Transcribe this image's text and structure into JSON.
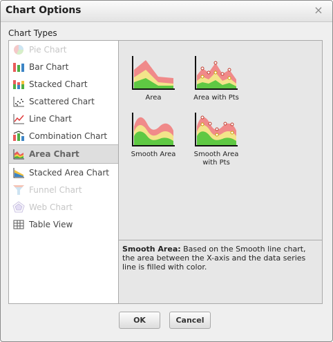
{
  "dialog": {
    "title": "Chart Options",
    "close_glyph": "×"
  },
  "chart_types": {
    "label": "Chart Types",
    "items": [
      {
        "label": "Pie Chart",
        "icon": "pie-chart-icon",
        "state": "disabled"
      },
      {
        "label": "Bar Chart",
        "icon": "bar-chart-icon",
        "state": "enabled"
      },
      {
        "label": "Stacked Chart",
        "icon": "stacked-chart-icon",
        "state": "enabled"
      },
      {
        "label": "Scattered Chart",
        "icon": "scatter-chart-icon",
        "state": "enabled"
      },
      {
        "label": "Line Chart",
        "icon": "line-chart-icon",
        "state": "enabled"
      },
      {
        "label": "Combination Chart",
        "icon": "combination-chart-icon",
        "state": "enabled"
      },
      {
        "label": "Area Chart",
        "icon": "area-chart-icon",
        "state": "selected"
      },
      {
        "label": "Stacked Area Chart",
        "icon": "stacked-area-chart-icon",
        "state": "enabled"
      },
      {
        "label": "Funnel Chart",
        "icon": "funnel-chart-icon",
        "state": "disabled"
      },
      {
        "label": "Web Chart",
        "icon": "web-chart-icon",
        "state": "disabled"
      },
      {
        "label": "Table View",
        "icon": "table-icon",
        "state": "enabled"
      }
    ]
  },
  "subtypes": [
    {
      "label": "Area"
    },
    {
      "label": "Area with Pts"
    },
    {
      "label": "Smooth Area"
    },
    {
      "label": "Smooth Area with Pts"
    }
  ],
  "description": {
    "title": "Smooth Area:",
    "text": "Based on the Smooth line chart, the area between the X-axis and the data series line is filled with color."
  },
  "buttons": {
    "ok": "OK",
    "cancel": "Cancel"
  },
  "colors": {
    "area_red": "#f08a8a",
    "area_yellow": "#f3e48a",
    "area_green": "#5fc843",
    "selected_bg": "#dedede"
  }
}
